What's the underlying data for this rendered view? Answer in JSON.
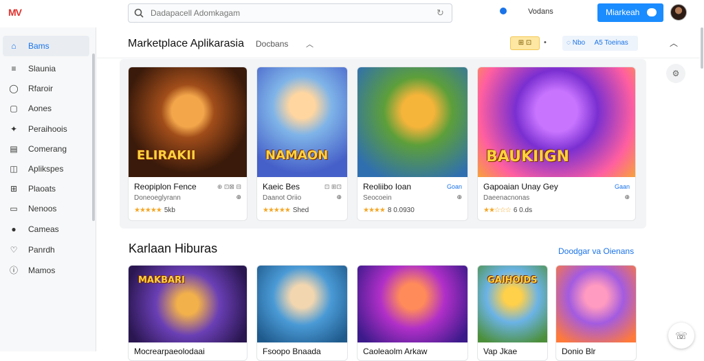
{
  "app": {
    "logo_left": "MV",
    "logo_right": ""
  },
  "search": {
    "placeholder": "Dadapacell Adomkagam"
  },
  "header": {
    "language": "Vodans",
    "primary_button": "Miarkeah",
    "accent": "#1a8cff"
  },
  "sidebar": {
    "items": [
      {
        "label": "Bams",
        "icon": "home-icon",
        "glyph": "⌂",
        "active": true
      },
      {
        "label": "Slaunia",
        "icon": "list-icon",
        "glyph": "≡"
      },
      {
        "label": "Rfaroir",
        "icon": "chat-icon",
        "glyph": "◯"
      },
      {
        "label": "Aones",
        "icon": "lock-icon",
        "glyph": "▢"
      },
      {
        "label": "Peraihoois",
        "icon": "puzzle-icon",
        "glyph": "✦"
      },
      {
        "label": "Comerang",
        "icon": "calendar-icon",
        "glyph": "▤"
      },
      {
        "label": "Aplikspes",
        "icon": "book-icon",
        "glyph": "◫"
      },
      {
        "label": "Plaoats",
        "icon": "grid-icon",
        "glyph": "⊞"
      },
      {
        "label": "Nenoos",
        "icon": "document-icon",
        "glyph": "▭"
      },
      {
        "label": "Cameas",
        "icon": "gamepad-icon",
        "glyph": "●"
      },
      {
        "label": "Panrdh",
        "icon": "heart-icon",
        "glyph": "♡"
      },
      {
        "label": "Mamos",
        "icon": "info-icon",
        "glyph": "ⓘ"
      }
    ]
  },
  "section1": {
    "title": "Marketplace Aplikarasia",
    "filter": "Docbans",
    "chip_yellow": "⊞ ⊡",
    "chip_dot": "•",
    "chip_blue_left": "Nbo",
    "chip_blue_right": "A5 Toeinas",
    "cards": [
      {
        "name": "Reopiplon Fence",
        "tag": "⊕ ⊡⊠ ⊟",
        "sub": "Doneoeglyrann",
        "sub_right": "⊕",
        "rating": "5kb",
        "stars": "★★★★★",
        "art_title": "ELIRAKII",
        "tag_blue": false
      },
      {
        "name": "Kaeic Bes",
        "tag": "⊡ ⊞⊡",
        "sub": "Daanot Oriio",
        "sub_right": "⊕",
        "rating": "Shed",
        "stars": "★★★★★",
        "art_title": "NAMAON",
        "tag_blue": false
      },
      {
        "name": "Reoliibo Ioan",
        "tag": "Goan",
        "sub": "Seocoein",
        "sub_right": "⊕",
        "rating": "8 0.0930",
        "stars": "★★★★",
        "art_title": "",
        "tag_blue": true
      },
      {
        "name": "Gapoaian Unay Gey",
        "tag": "Gaan",
        "sub": "Daeenacnonas",
        "sub_right": "⊕",
        "rating": "6 0.ds",
        "stars": "★★☆☆☆",
        "art_title": "BAUKIIGN",
        "tag_blue": true
      }
    ]
  },
  "section2": {
    "title": "Karlaan Hiburas",
    "see_all": "Doodgar va Oienans",
    "cards": [
      {
        "name": "Mocrearpaeolodaai",
        "art_title": "MAKBARI"
      },
      {
        "name": "Fsoopo Bnaada",
        "art_title": ""
      },
      {
        "name": "Caoleaolm Arkaw",
        "art_title": ""
      },
      {
        "name": "Vap Jkae",
        "art_title": "GAIHOIDS"
      },
      {
        "name": "Donio Blr",
        "art_title": ""
      }
    ]
  }
}
